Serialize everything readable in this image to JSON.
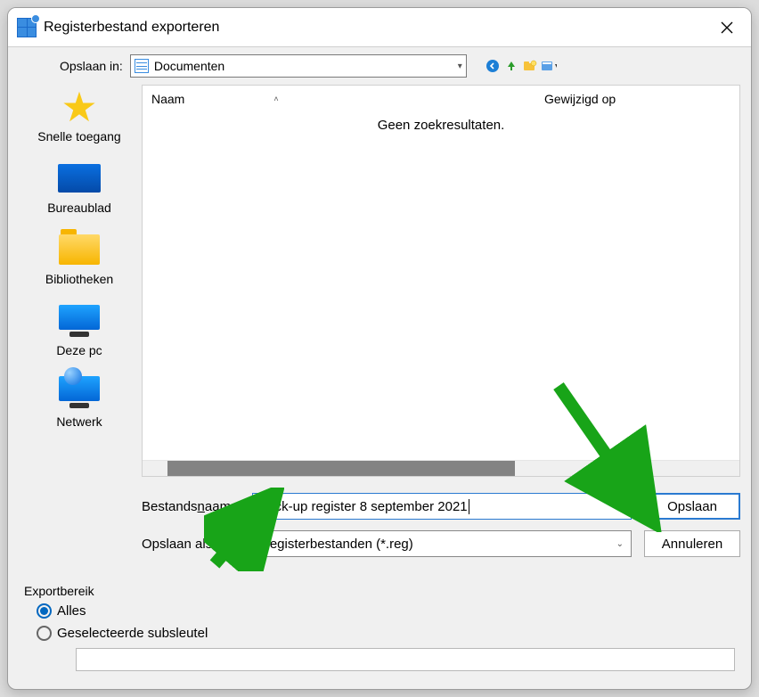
{
  "titlebar": {
    "title": "Registerbestand exporteren"
  },
  "toolbar": {
    "save_in_label": "Opslaan in:",
    "current_folder": "Documenten"
  },
  "places": {
    "quick_access": "Snelle toegang",
    "desktop": "Bureaublad",
    "libraries": "Bibliotheken",
    "this_pc": "Deze pc",
    "network": "Netwerk"
  },
  "file_list": {
    "col_name": "Naam",
    "col_modified": "Gewijzigd op",
    "empty_message": "Geen zoekresultaten."
  },
  "form": {
    "filename_label_pre": "Bestands",
    "filename_label_u": "n",
    "filename_label_post": "aam:",
    "filename_value": "back-up register 8 september 2021",
    "save_as_label": "Opslaan als:",
    "save_as_value": "Registerbestanden (*.reg)",
    "save_button": "Opslaan",
    "cancel_button": "Annuleren"
  },
  "export_range": {
    "legend": "Exportbereik",
    "option_all": "Alles",
    "option_selected": "Geselecteerde subsleutel",
    "subkey_value": ""
  }
}
